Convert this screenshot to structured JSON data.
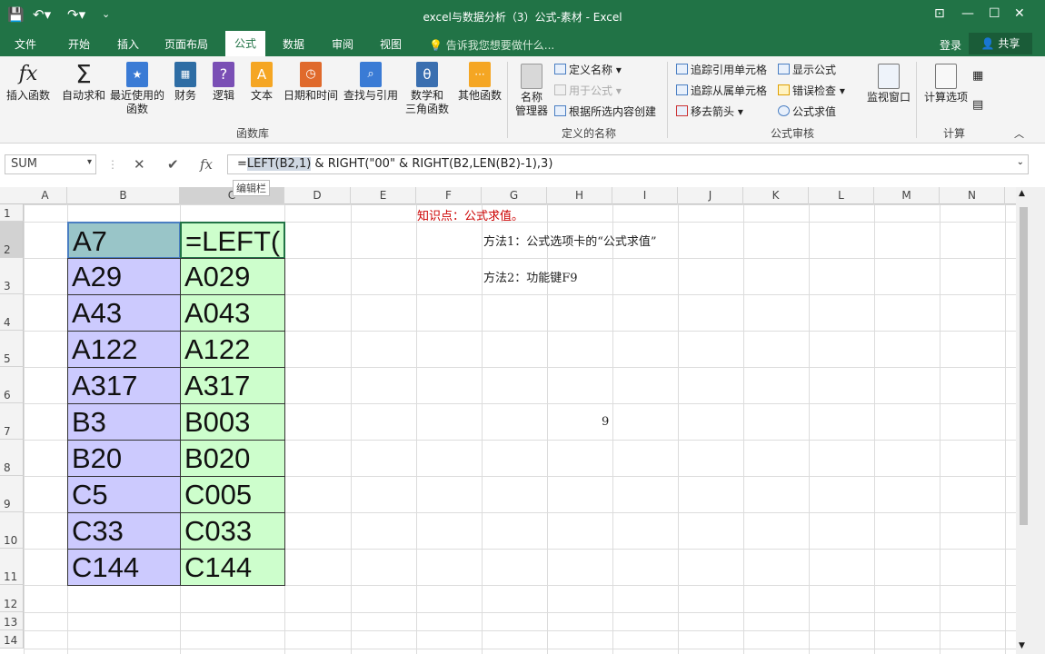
{
  "window": {
    "title": "excel与数据分析（3）公式-素材 - Excel"
  },
  "quick_access": {
    "save_icon": "save-icon",
    "undo_icon": "undo-icon",
    "redo_icon": "redo-icon",
    "customize_icon": "customize-icon"
  },
  "tabs": [
    "文件",
    "开始",
    "插入",
    "页面布局",
    "公式",
    "数据",
    "审阅",
    "视图"
  ],
  "active_tab": "公式",
  "tell_me": "告诉我您想要做什么...",
  "login": "登录",
  "share": "共享",
  "ribbon": {
    "insert_function": "插入函数",
    "autosum": "自动求和",
    "recent": [
      "最近使用的",
      "函数"
    ],
    "financial": "财务",
    "logical": "逻辑",
    "text": "文本",
    "datetime": "日期和时间",
    "lookup": "查找与引用",
    "math": [
      "数学和",
      "三角函数"
    ],
    "more": "其他函数",
    "group_library": "函数库",
    "name_manager": [
      "名称",
      "管理器"
    ],
    "define_name": "定义名称",
    "use_in_formula": "用于公式",
    "create_from_selection": "根据所选内容创建",
    "group_names": "定义的名称",
    "trace_precedents": "追踪引用单元格",
    "trace_dependents": "追踪从属单元格",
    "remove_arrows": "移去箭头",
    "show_formulas": "显示公式",
    "error_checking": "错误检查",
    "evaluate_formula": "公式求值",
    "group_auditing": "公式审核",
    "watch_window": "监视窗口",
    "calc_options": "计算选项",
    "group_calc": "计算"
  },
  "formula_bar": {
    "name_box": "SUM",
    "formula_parts": [
      "=",
      "LEFT(B2,1)",
      " & RIGHT(\"00\" & RIGHT(B2,LEN(B2)-1),3)"
    ],
    "tooltip": "编辑栏"
  },
  "columns": [
    "A",
    "B",
    "C",
    "D",
    "E",
    "F",
    "G",
    "H",
    "I",
    "J",
    "K",
    "L",
    "M",
    "N"
  ],
  "rows": [
    "1",
    "2",
    "3",
    "4",
    "5",
    "6",
    "7",
    "8",
    "9",
    "10",
    "11",
    "12",
    "13",
    "14"
  ],
  "cells": {
    "B": [
      "A7",
      "A29",
      "A43",
      "A122",
      "A317",
      "B3",
      "B20",
      "C5",
      "C33",
      "C144"
    ],
    "C": [
      "=LEFT(",
      "A029",
      "A043",
      "A122",
      "A317",
      "B003",
      "B020",
      "C005",
      "C033",
      "C144"
    ]
  },
  "notes": {
    "f1": "知识点：公式求值。",
    "g2": "方法1：公式选项卡的“公式求值”",
    "g3": "方法2：功能键F9",
    "h7": "9"
  },
  "colors": {
    "green": "#217346",
    "col_b": "#cccafe",
    "col_c": "#cdfecc",
    "selected": "#99c5c8",
    "red_note": "#cc0000"
  }
}
